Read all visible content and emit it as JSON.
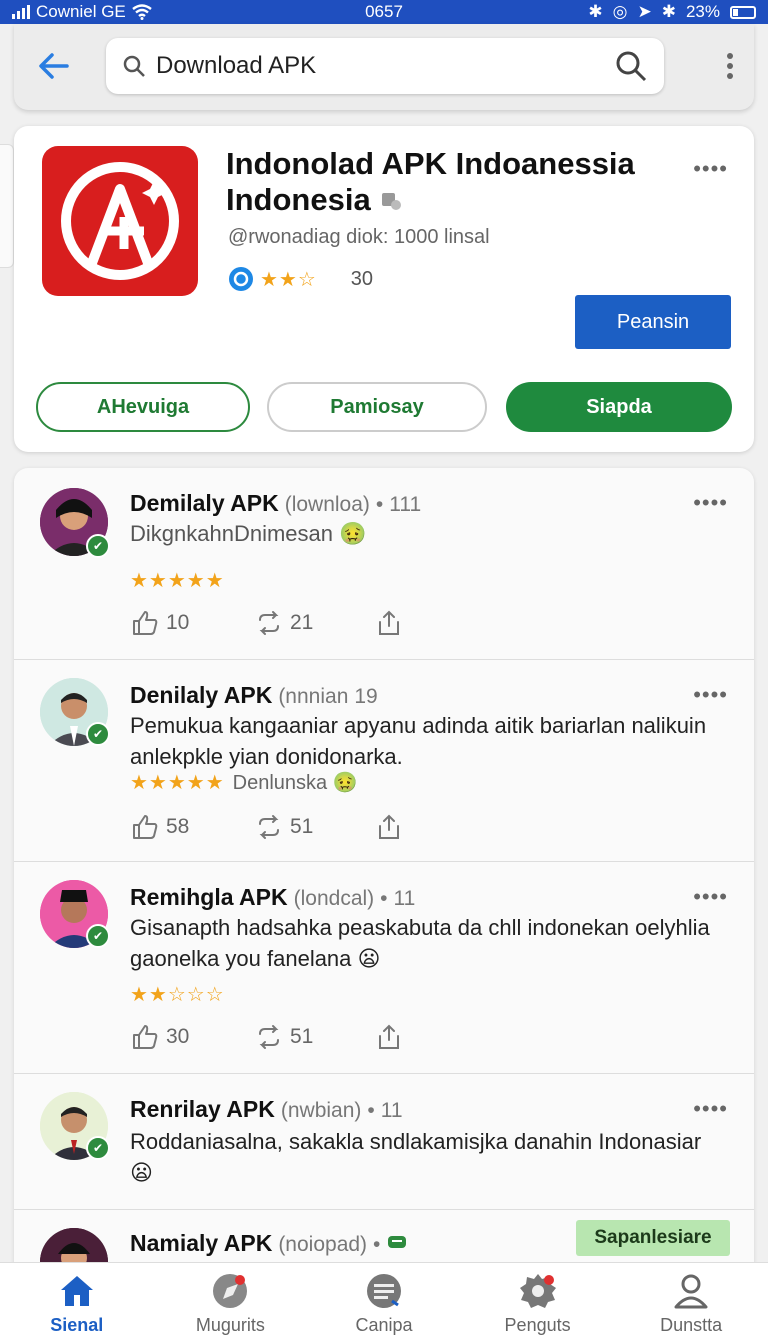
{
  "status": {
    "carrier": "Cowniel GE",
    "time": "0657",
    "battery": "23%"
  },
  "search": {
    "query": "Download APK"
  },
  "app": {
    "title_line1": "Indonolad APK Indoanessia",
    "title_line2": "Indonesia",
    "subtitle": "@rwonadiag diok: 1000 linsal",
    "rating_count": "30",
    "primary_button": "Peansin",
    "pill_a": "AHevuiga",
    "pill_b": "Pamiosay",
    "pill_c": "Siapda"
  },
  "posts": [
    {
      "name": "Demilaly APK",
      "handle": "(lownloa)",
      "dot": "•",
      "time": "111",
      "body": "DikgnkahnDnimesan 🤢",
      "stars": "★★★★★",
      "rating_text": "",
      "likes": "10",
      "reposts": "21"
    },
    {
      "name": "Denilaly APK",
      "handle": "(nnnian",
      "dot": "",
      "time": "19",
      "body": "Pemukua kangaaniar apyanu adinda aitik bariarlan nalikuin anlekpkle yian donidonarka.",
      "stars": "★★★★★",
      "rating_text": "Denlunska 🤢",
      "likes": "58",
      "reposts": "51"
    },
    {
      "name": "Remihgla APK",
      "handle": "(londcal)",
      "dot": "•",
      "time": "11",
      "body": "Gisanapth hadsahka peaskabuta da chll indonekan oelyhlia gaonelka you fanelana 😦",
      "stars": "★★☆☆☆",
      "rating_text": "",
      "likes": "30",
      "reposts": "51"
    },
    {
      "name": "Renrilay APK",
      "handle": "(nwbian)",
      "dot": "•",
      "time": "11",
      "body": "Roddaniasalna, sakakla sndlakamisjka danahin Indonasiar 😦",
      "stars": "",
      "rating_text": "",
      "likes": "",
      "reposts": ""
    },
    {
      "name": "Namialy APK",
      "handle": "(noiopad)",
      "dot": "•",
      "time": "",
      "body": "",
      "tag": "Sapanlesiare"
    }
  ],
  "nav": [
    {
      "label": "Sienal",
      "icon": "home-icon",
      "active": true
    },
    {
      "label": "Mugurits",
      "icon": "compass-icon",
      "active": false
    },
    {
      "label": "Canipa",
      "icon": "message-icon",
      "active": false
    },
    {
      "label": "Penguts",
      "icon": "gear-icon",
      "active": false
    },
    {
      "label": "Dunstta",
      "icon": "profile-icon",
      "active": false
    }
  ],
  "colors": {
    "statusbar": "#1f4fbf",
    "primary": "#1c5fc4",
    "green": "#1f8a3e",
    "applogo": "#d81e1e",
    "star": "#f2a31a"
  }
}
